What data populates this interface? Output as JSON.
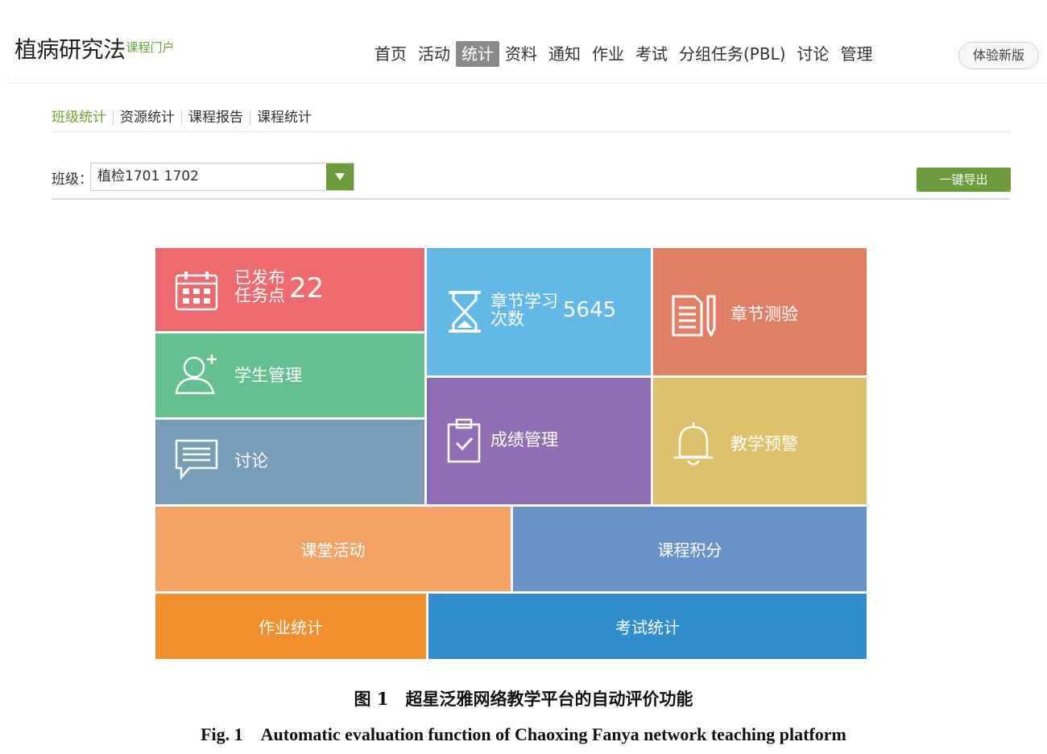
{
  "header": {
    "course_title": "植病研究法",
    "course_portal": "课程门户",
    "nav": [
      {
        "label": "首页"
      },
      {
        "label": "活动"
      },
      {
        "label": "统计"
      },
      {
        "label": "资料"
      },
      {
        "label": "通知"
      },
      {
        "label": "作业"
      },
      {
        "label": "考试"
      },
      {
        "label": "分组任务(PBL)"
      },
      {
        "label": "讨论"
      },
      {
        "label": "管理"
      }
    ],
    "active_nav": "统计",
    "new_version_button": "体验新版"
  },
  "subtabs": [
    {
      "label": "班级统计"
    },
    {
      "label": "资源统计"
    },
    {
      "label": "课程报告"
    },
    {
      "label": "课程统计"
    }
  ],
  "active_subtab": "班级统计",
  "toolbar": {
    "class_label": "班级：",
    "class_value": "植检1701 1702",
    "export_button": "一键导出"
  },
  "tiles": {
    "published_tasks": {
      "label": "已发布任务点",
      "value": "22",
      "color": "#ef6a6e",
      "icon": "calendar-icon"
    },
    "chapter_study": {
      "label": "章节学习次数",
      "value": "5645",
      "color": "#62b8e6",
      "icon": "hourglass-icon"
    },
    "chapter_quiz": {
      "label": "章节测验",
      "color": "#e07f66",
      "icon": "document-pencil-icon"
    },
    "student_mgmt": {
      "label": "学生管理",
      "color": "#65c08f",
      "icon": "user-add-icon"
    },
    "grade_mgmt": {
      "label": "成绩管理",
      "color": "#8e6fb5",
      "icon": "clipboard-check-icon"
    },
    "teaching_alert": {
      "label": "教学预警",
      "color": "#ddc26b",
      "icon": "bell-icon"
    },
    "discussion": {
      "label": "讨论",
      "color": "#789db8",
      "icon": "chat-icon"
    },
    "class_activity": {
      "label": "课堂活动",
      "color": "#f2a467"
    },
    "course_points": {
      "label": "课程积分",
      "color": "#6a93cb"
    },
    "homework_stats": {
      "label": "作业统计",
      "color": "#f48f2f"
    },
    "exam_stats": {
      "label": "考试统计",
      "color": "#318ece"
    }
  },
  "caption": {
    "cn": "图 1　超星泛雅网络教学平台的自动评价功能",
    "en": "Fig. 1　Automatic evaluation function of Chaoxing Fanya network teaching platform"
  }
}
